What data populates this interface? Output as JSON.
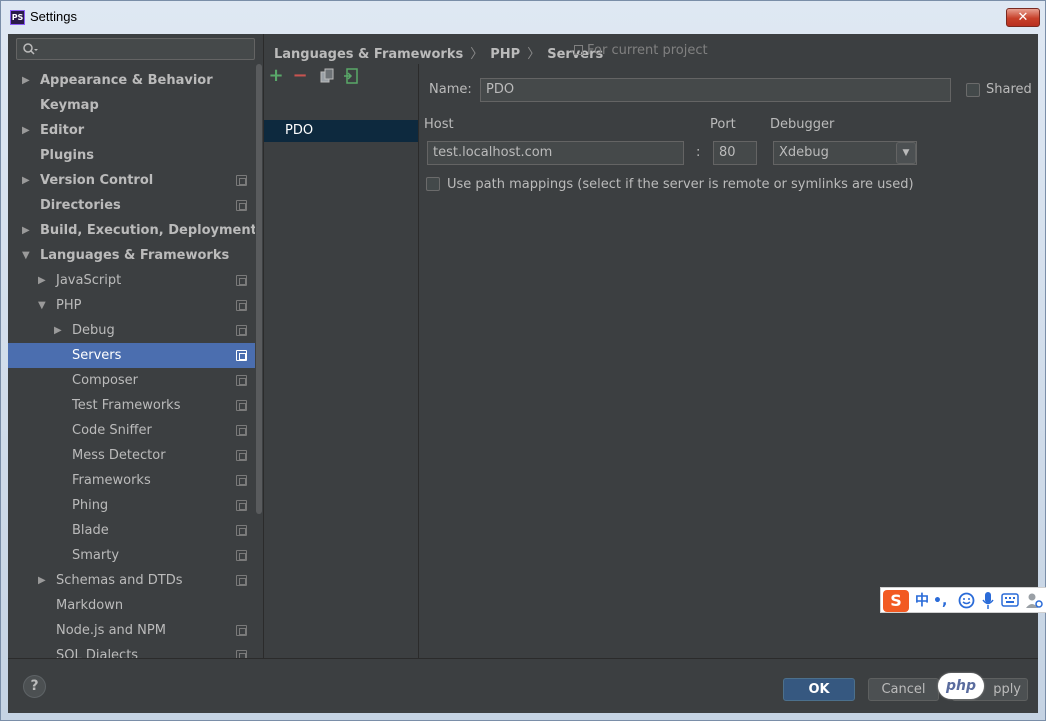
{
  "window": {
    "title": "Settings",
    "app_icon": "PS"
  },
  "search": {
    "placeholder": ""
  },
  "tree": [
    {
      "label": "Appearance & Behavior",
      "level": 0,
      "arrow": "right",
      "bold": true,
      "project": false
    },
    {
      "label": "Keymap",
      "level": 0,
      "arrow": "",
      "bold": true,
      "project": false
    },
    {
      "label": "Editor",
      "level": 0,
      "arrow": "right",
      "bold": true,
      "project": false
    },
    {
      "label": "Plugins",
      "level": 0,
      "arrow": "",
      "bold": true,
      "project": false
    },
    {
      "label": "Version Control",
      "level": 0,
      "arrow": "right",
      "bold": true,
      "project": true
    },
    {
      "label": "Directories",
      "level": 0,
      "arrow": "",
      "bold": true,
      "project": true
    },
    {
      "label": "Build, Execution, Deployment",
      "level": 0,
      "arrow": "right",
      "bold": true,
      "project": false
    },
    {
      "label": "Languages & Frameworks",
      "level": 0,
      "arrow": "down",
      "bold": true,
      "project": false
    },
    {
      "label": "JavaScript",
      "level": 1,
      "arrow": "right",
      "bold": false,
      "project": true
    },
    {
      "label": "PHP",
      "level": 1,
      "arrow": "down",
      "bold": false,
      "project": true
    },
    {
      "label": "Debug",
      "level": 2,
      "arrow": "right",
      "bold": false,
      "project": true
    },
    {
      "label": "Servers",
      "level": 2,
      "arrow": "",
      "bold": false,
      "project": true,
      "selected": true
    },
    {
      "label": "Composer",
      "level": 2,
      "arrow": "",
      "bold": false,
      "project": true
    },
    {
      "label": "Test Frameworks",
      "level": 2,
      "arrow": "",
      "bold": false,
      "project": true
    },
    {
      "label": "Code Sniffer",
      "level": 2,
      "arrow": "",
      "bold": false,
      "project": true
    },
    {
      "label": "Mess Detector",
      "level": 2,
      "arrow": "",
      "bold": false,
      "project": true
    },
    {
      "label": "Frameworks",
      "level": 2,
      "arrow": "",
      "bold": false,
      "project": true
    },
    {
      "label": "Phing",
      "level": 2,
      "arrow": "",
      "bold": false,
      "project": true
    },
    {
      "label": "Blade",
      "level": 2,
      "arrow": "",
      "bold": false,
      "project": true
    },
    {
      "label": "Smarty",
      "level": 2,
      "arrow": "",
      "bold": false,
      "project": true
    },
    {
      "label": "Schemas and DTDs",
      "level": 1,
      "arrow": "right",
      "bold": false,
      "project": true
    },
    {
      "label": "Markdown",
      "level": 1,
      "arrow": "",
      "bold": false,
      "project": false
    },
    {
      "label": "Node.js and NPM",
      "level": 1,
      "arrow": "",
      "bold": false,
      "project": true
    },
    {
      "label": "SQL Dialects",
      "level": 1,
      "arrow": "",
      "bold": false,
      "project": true
    }
  ],
  "breadcrumb": {
    "part1": "Languages & Frameworks",
    "part2": "PHP",
    "part3": "Servers",
    "sep": "〉",
    "for_current_project": "For current project"
  },
  "servers": {
    "toolbar": {
      "add": "+",
      "remove": "−"
    },
    "items": [
      "PDO"
    ]
  },
  "form": {
    "name_label": "Name:",
    "name_value": "PDO",
    "shared_label": "Shared",
    "host_label": "Host",
    "host_value": "test.localhost.com",
    "colon": ":",
    "port_label": "Port",
    "port_value": "80",
    "debugger_label": "Debugger",
    "debugger_value": "Xdebug",
    "path_mappings_label": "Use path mappings (select if the server is remote or symlinks are used)"
  },
  "footer": {
    "help": "?",
    "ok": "OK",
    "cancel": "Cancel",
    "apply_tail": "pply"
  },
  "ime": {
    "logo": "S",
    "lang": "中",
    "punct": "•,",
    "php_badge": "php"
  },
  "colors": {
    "selection": "#4b6eaf",
    "panel": "#3c3f41",
    "primary_button": "#365880"
  }
}
